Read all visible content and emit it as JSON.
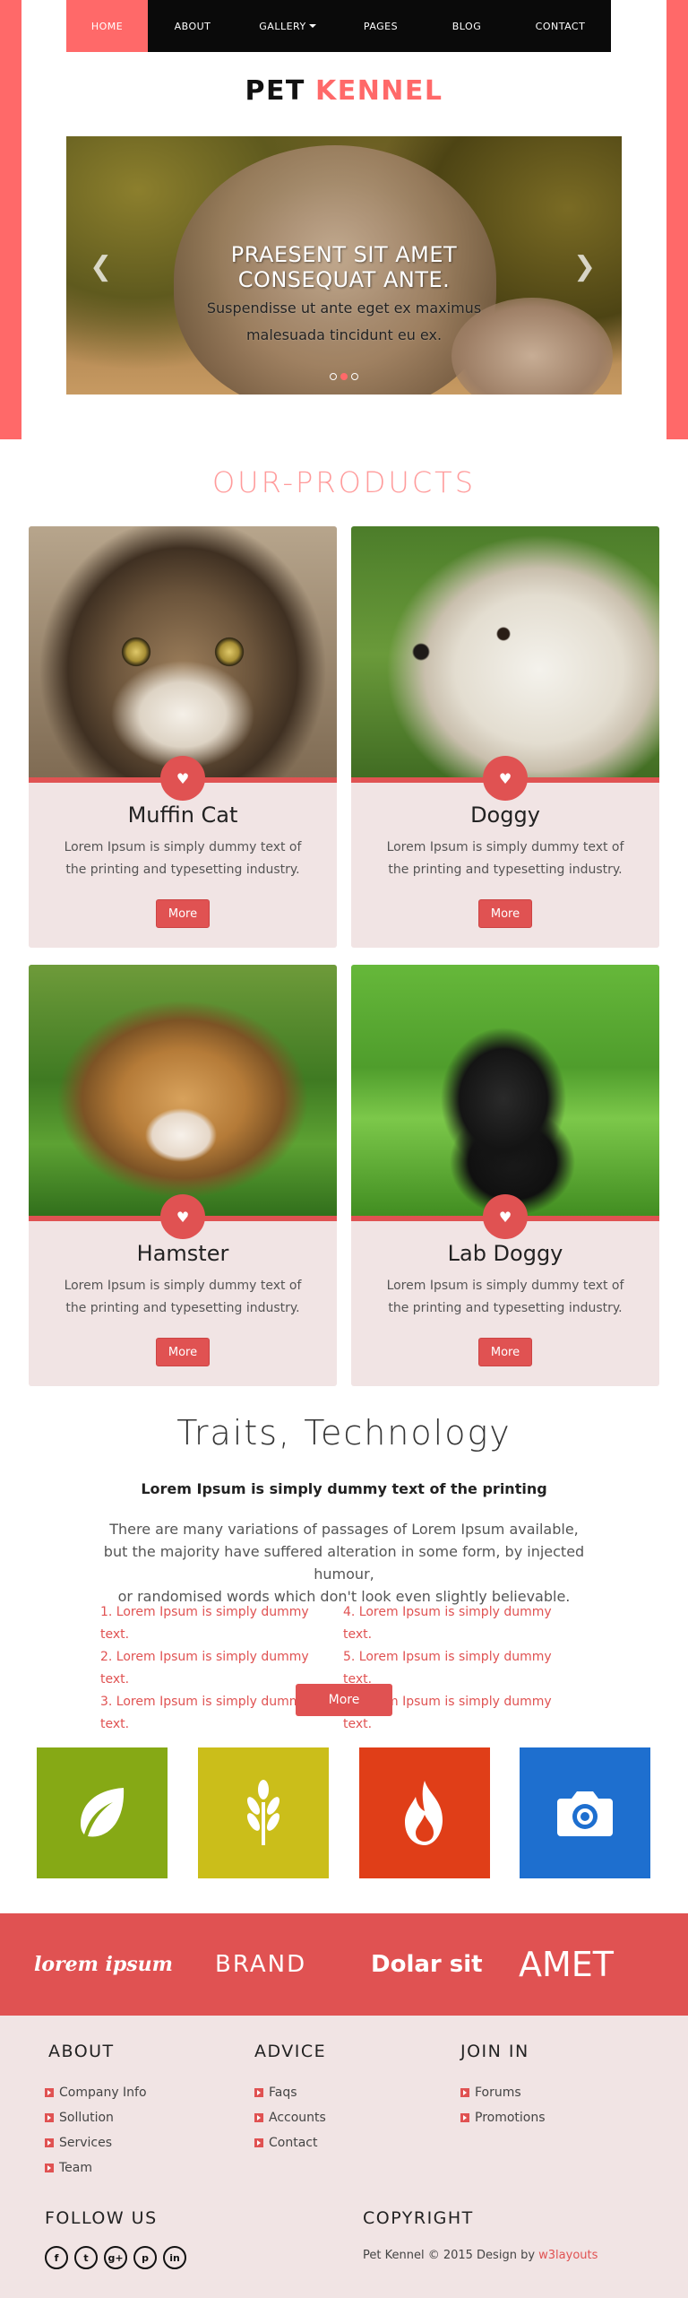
{
  "nav": {
    "items": [
      {
        "label": "HOME",
        "active": true
      },
      {
        "label": "ABOUT",
        "active": false
      },
      {
        "label": "GALLERY",
        "active": false,
        "dropdown": true
      },
      {
        "label": "PAGES",
        "active": false
      },
      {
        "label": "BLOG",
        "active": false
      },
      {
        "label": "CONTACT",
        "active": false
      }
    ]
  },
  "logo": {
    "part1": "PET",
    "part2": "KENNEL"
  },
  "slider": {
    "heading_line1": "PRAESENT SIT AMET",
    "heading_line2": "CONSEQUAT ANTE.",
    "text_line1": "Suspendisse ut ante eget ex maximus",
    "text_line2": "malesuada tincidunt eu ex.",
    "prev_icon": "chevron-left-icon",
    "next_icon": "chevron-right-icon",
    "dots": 3,
    "active_dot": 2
  },
  "products": {
    "title": "OUR-PRODUCTS",
    "items": [
      {
        "name": "Muffin Cat",
        "desc": "Lorem Ipsum is simply dummy text of the printing and typesetting industry.",
        "button": "More"
      },
      {
        "name": "Doggy",
        "desc": "Lorem Ipsum is simply dummy text of the printing and typesetting industry.",
        "button": "More"
      },
      {
        "name": "Hamster",
        "desc": "Lorem Ipsum is simply dummy text of the printing and typesetting industry.",
        "button": "More"
      },
      {
        "name": "Lab Doggy",
        "desc": "Lorem Ipsum is simply dummy text of the printing and typesetting industry.",
        "button": "More"
      }
    ]
  },
  "traits": {
    "title": "Traits, Technology",
    "subtitle": "Lorem Ipsum is simply dummy text of the printing",
    "para_line1": "There are many variations of passages of Lorem Ipsum available,",
    "para_line2": "but the majority have suffered alteration in some form, by injected humour,",
    "para_line3": "or randomised words which don't look even slightly believable.",
    "list_col1": [
      "1. Lorem Ipsum is simply dummy text.",
      "2. Lorem Ipsum is simply dummy text.",
      "3. Lorem Ipsum is simply dummy text."
    ],
    "list_col2": [
      "4. Lorem Ipsum is simply dummy text.",
      "5. Lorem Ipsum is simply dummy text.",
      "6. Lorem Ipsum is simply dummy text."
    ],
    "button": "More",
    "tiles": [
      {
        "icon": "leaf-icon",
        "color": "#86a915"
      },
      {
        "icon": "wheat-icon",
        "color": "#cbbe1a"
      },
      {
        "icon": "fire-icon",
        "color": "#e03e18"
      },
      {
        "icon": "camera-icon",
        "color": "#1e6fcf"
      }
    ]
  },
  "brands": [
    "lorem ipsum",
    "BRAND",
    "Dolar sit",
    "AMET"
  ],
  "footer": {
    "about": {
      "title": "ABOUT",
      "links": [
        "Company Info",
        "Sollution",
        "Services",
        "Team"
      ]
    },
    "advice": {
      "title": "ADVICE",
      "links": [
        "Faqs",
        "Accounts",
        "Contact"
      ]
    },
    "join": {
      "title": "JOIN IN",
      "links": [
        "Forums",
        "Promotions"
      ]
    },
    "follow": {
      "title": "FOLLOW US",
      "icons": [
        "facebook-icon",
        "twitter-icon",
        "google-plus-icon",
        "pinterest-icon",
        "linkedin-icon"
      ]
    },
    "copyright": {
      "title": "COPYRIGHT",
      "text": "Pet Kennel © 2015 Design by ",
      "link": "w3layouts"
    }
  },
  "colors": {
    "accent": "#ff6969",
    "button": "#e05252",
    "nav_bg": "#0a0a0a",
    "card_bg": "#f1e4e4"
  }
}
